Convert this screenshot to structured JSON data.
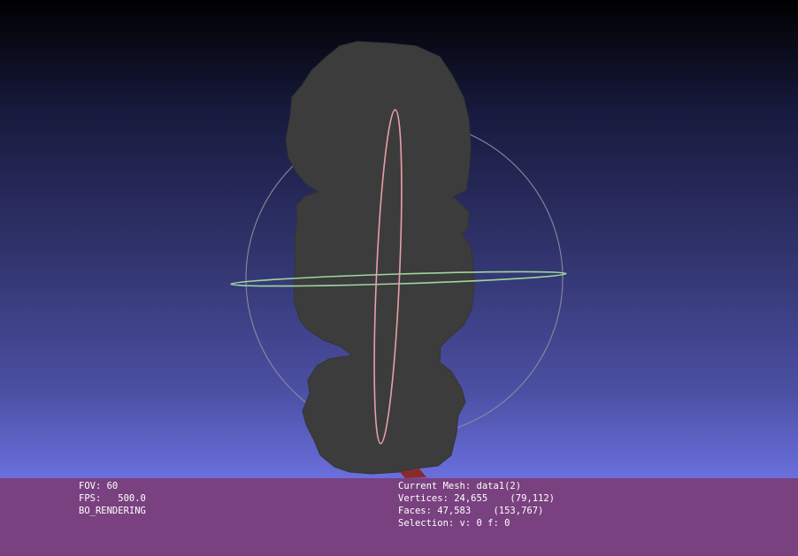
{
  "viewer": {
    "background_top_color": "#000000",
    "background_bottom_color": "#6a6fdd",
    "info_bar_color": "#7a407c",
    "mesh_color": "#3c3c3c",
    "trackball": {
      "sphere_color": "#8c8c9c",
      "horizontal_ring_color": "#9fd69f",
      "vertical_ring_color": "#e8a0a8"
    }
  },
  "info_left": {
    "fov": "FOV: 60",
    "fps": "FPS:   500.0",
    "mode": "BO_RENDERING"
  },
  "info_right": {
    "mesh": "Current Mesh: data1(2)",
    "vertices": "Vertices: 24,655    (79,112)",
    "faces": "Faces: 47,583    (153,767)",
    "selection": "Selection: v: 0 f: 0"
  }
}
